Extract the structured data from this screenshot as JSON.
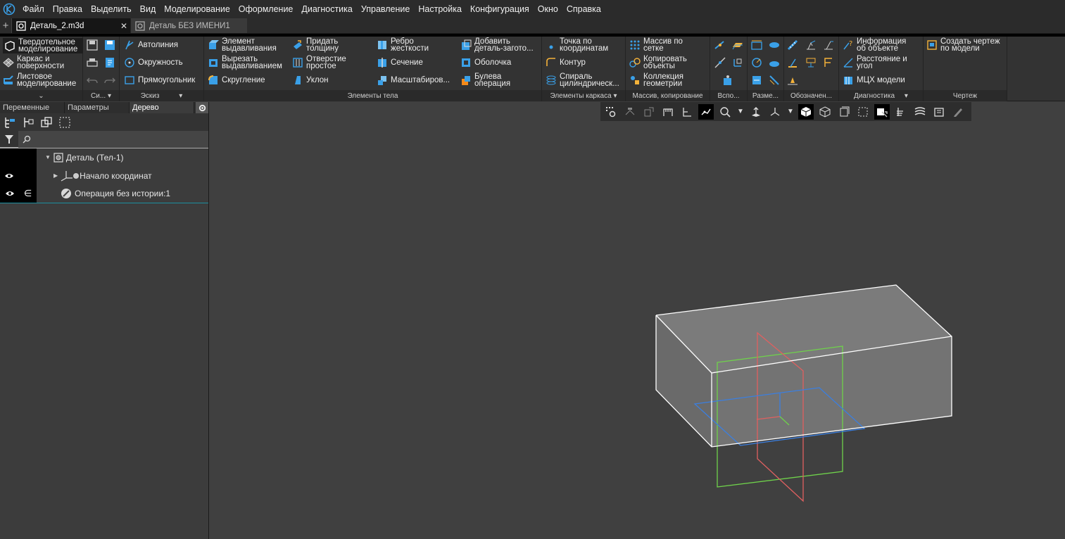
{
  "menu": [
    "Файл",
    "Правка",
    "Выделить",
    "Вид",
    "Моделирование",
    "Оформление",
    "Диагностика",
    "Управление",
    "Настройка",
    "Конфигурация",
    "Окно",
    "Справка"
  ],
  "tabs": [
    {
      "label": "Деталь_2.m3d",
      "active": true
    },
    {
      "label": "Деталь БЕЗ ИМЕНИ1",
      "active": false
    }
  ],
  "ribbon": {
    "modes": [
      {
        "l1": "Твердотельное",
        "l2": "моделирование"
      },
      {
        "l1": "Каркас и",
        "l2": "поверхности"
      },
      {
        "l1": "Листовое",
        "l2": "моделирование"
      }
    ],
    "sys_footer": "Си...",
    "sketch": {
      "footer": "Эскиз",
      "items": [
        "Автолиния",
        "Окружность",
        "Прямоугольник"
      ]
    },
    "body": {
      "footer": "Элементы тела",
      "items": [
        {
          "l1": "Элемент",
          "l2": "выдавливания"
        },
        {
          "l1": "Вырезать",
          "l2": "выдавливанием"
        },
        {
          "l1": "Скругление",
          "l2": ""
        },
        {
          "l1": "Придать",
          "l2": "толщину"
        },
        {
          "l1": "Отверстие",
          "l2": "простое"
        },
        {
          "l1": "Уклон",
          "l2": ""
        },
        {
          "l1": "Ребро",
          "l2": "жесткости"
        },
        {
          "l1": "Сечение",
          "l2": ""
        },
        {
          "l1": "Масштабиров...",
          "l2": ""
        },
        {
          "l1": "Добавить",
          "l2": "деталь-загото..."
        },
        {
          "l1": "Оболочка",
          "l2": ""
        },
        {
          "l1": "Булева",
          "l2": "операция"
        }
      ]
    },
    "frame": {
      "footer": "Элементы каркаса",
      "items": [
        {
          "l1": "Точка по",
          "l2": "координатам"
        },
        {
          "l1": "Контур",
          "l2": ""
        },
        {
          "l1": "Спираль",
          "l2": "цилиндрическ..."
        }
      ]
    },
    "arrays": {
      "footer": "Массив, копирование",
      "items": [
        {
          "l1": "Массив по",
          "l2": "сетке"
        },
        {
          "l1": "Копировать",
          "l2": "объекты"
        },
        {
          "l1": "Коллекция",
          "l2": "геометрии"
        }
      ]
    },
    "aux_footer": "Вспо...",
    "dims_footer": "Разме...",
    "annot_footer": "Обозначен...",
    "diag": {
      "footer": "Диагностика",
      "items": [
        {
          "l1": "Информация",
          "l2": "об объекте"
        },
        {
          "l1": "Расстояние и",
          "l2": "угол"
        },
        {
          "l1": "МЦХ модели",
          "l2": ""
        }
      ]
    },
    "drawing": {
      "footer": "Чертеж",
      "l1": "Создать чертеж",
      "l2": "по модели"
    }
  },
  "panel": {
    "tabs": [
      "Переменные",
      "Параметры",
      "Дерево"
    ],
    "active_tab": "Дерево",
    "tree": [
      {
        "label": "Деталь (Тел-1)"
      },
      {
        "label": "Начало координат"
      },
      {
        "label": "Операция без истории:1"
      }
    ]
  },
  "colors": {
    "accent": "#1c8fa0",
    "plane_red": "#e06060",
    "plane_green": "#6fd24b",
    "plane_blue": "#3b7fe0",
    "edge": "#ffffff"
  }
}
